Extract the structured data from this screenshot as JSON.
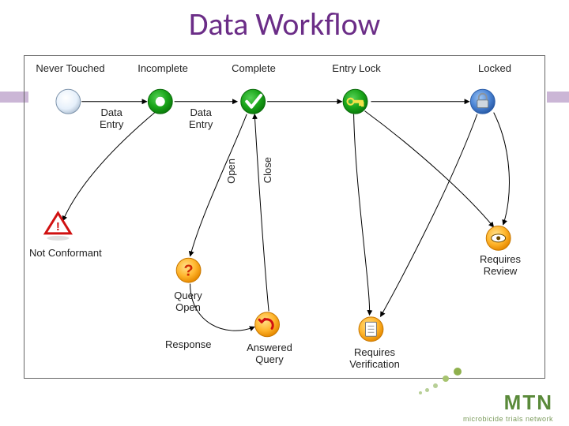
{
  "title": "Data Workflow",
  "nodes": {
    "never_touched": {
      "label": "Never Touched"
    },
    "incomplete": {
      "label": "Incomplete"
    },
    "complete": {
      "label": "Complete"
    },
    "entry_lock": {
      "label": "Entry Lock"
    },
    "locked": {
      "label": "Locked"
    },
    "not_conformant": {
      "label": "Not Conformant"
    },
    "query_open": {
      "label": "Query\nOpen"
    },
    "answered_query": {
      "label": "Answered\nQuery"
    },
    "requires_verification": {
      "label": "Requires\nVerification"
    },
    "requires_review": {
      "label": "Requires\nReview"
    }
  },
  "edges": {
    "nt_inc": "Data\nEntry",
    "inc_cmp": "Data\nEntry",
    "open": "Open",
    "close": "Close",
    "response": "Response"
  },
  "logo": {
    "brand": "MTN",
    "tag": "microbicide trials network"
  }
}
